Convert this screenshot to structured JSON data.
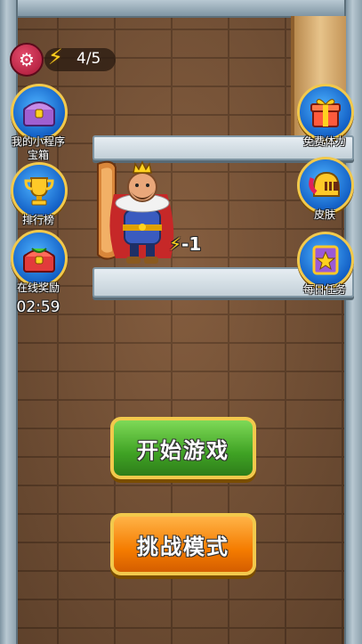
{
  "hud": {
    "settings_icon": "gear-icon",
    "energy_icon": "lightning-icon",
    "energy_text": "4/5"
  },
  "left_buttons": [
    {
      "name": "my-miniprogram-chest",
      "label": "我的小程序\n宝箱",
      "icon": "treasure-chest-icon"
    },
    {
      "name": "leaderboard",
      "label": "排行榜",
      "icon": "trophy-icon"
    },
    {
      "name": "online-reward",
      "label": "在线奖励",
      "icon": "gift-chest-icon",
      "timer": "02:59"
    }
  ],
  "right_buttons": [
    {
      "name": "free-energy",
      "label": "免费体力",
      "icon": "gift-box-icon"
    },
    {
      "name": "skin",
      "label": "皮肤",
      "icon": "helmet-icon"
    },
    {
      "name": "daily-task",
      "label": "每日任务",
      "icon": "star-card-icon"
    }
  ],
  "level": {
    "cost_label": "-1"
  },
  "menu": {
    "start_label": "开始游戏",
    "challenge_label": "挑战模式"
  },
  "colors": {
    "start_button": "#3fa224",
    "challenge_button": "#f57c00",
    "button_border": "#f2c94c",
    "side_button": "#1360c6"
  }
}
